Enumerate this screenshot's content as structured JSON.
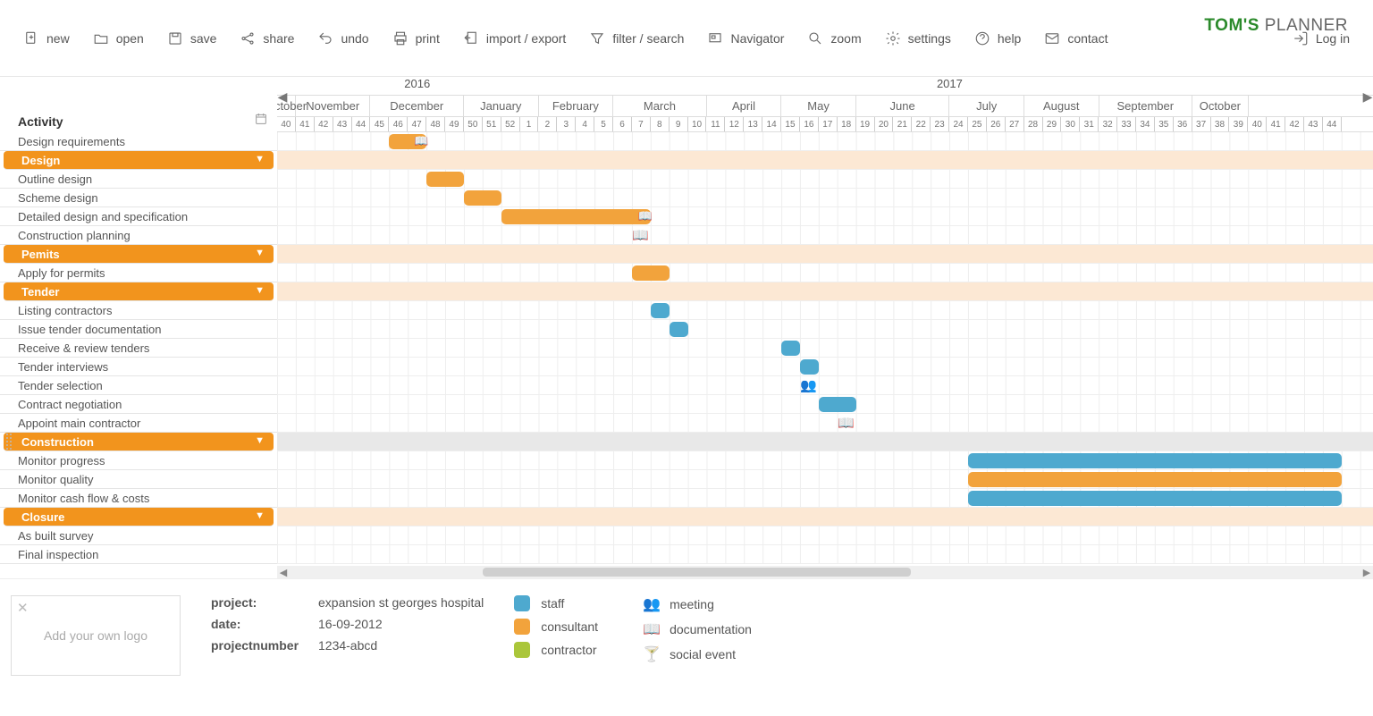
{
  "brand": {
    "strong": "TOM'S",
    "light": " PLANNER"
  },
  "toolbar": {
    "items": [
      "new",
      "open",
      "save",
      "share",
      "undo",
      "print",
      "import / export",
      "filter / search",
      "Navigator",
      "zoom",
      "settings",
      "help",
      "contact"
    ],
    "login": "Log in"
  },
  "timeline": {
    "years": [
      {
        "label": "2016",
        "span": 15
      },
      {
        "label": "2017",
        "span": 42
      }
    ],
    "months": [
      {
        "label": "October",
        "weeks": 1
      },
      {
        "label": "November",
        "weeks": 4
      },
      {
        "label": "December",
        "weeks": 5
      },
      {
        "label": "January",
        "weeks": 4
      },
      {
        "label": "February",
        "weeks": 4
      },
      {
        "label": "March",
        "weeks": 5
      },
      {
        "label": "April",
        "weeks": 4
      },
      {
        "label": "May",
        "weeks": 4
      },
      {
        "label": "June",
        "weeks": 5
      },
      {
        "label": "July",
        "weeks": 4
      },
      {
        "label": "August",
        "weeks": 4
      },
      {
        "label": "September",
        "weeks": 5
      },
      {
        "label": "October",
        "weeks": 3
      }
    ],
    "weeks": [
      40,
      41,
      42,
      43,
      44,
      45,
      46,
      47,
      48,
      49,
      50,
      51,
      52,
      1,
      2,
      3,
      4,
      5,
      6,
      7,
      8,
      9,
      10,
      11,
      12,
      13,
      14,
      15,
      16,
      17,
      18,
      19,
      20,
      21,
      22,
      23,
      24,
      25,
      26,
      27,
      28,
      29,
      30,
      31,
      32,
      33,
      34,
      35,
      36,
      37,
      38,
      39,
      40,
      41,
      42,
      43,
      44
    ]
  },
  "activity_header": "Activity",
  "rows": [
    {
      "label": "Design requirements",
      "type": "task",
      "bar": {
        "start": 6,
        "span": 2,
        "color": "orange",
        "icon": "📖"
      }
    },
    {
      "label": "Design",
      "type": "group"
    },
    {
      "label": "Outline design",
      "type": "task",
      "bar": {
        "start": 8,
        "span": 2,
        "color": "orange"
      }
    },
    {
      "label": "Scheme design",
      "type": "task",
      "bar": {
        "start": 10,
        "span": 2,
        "color": "orange"
      }
    },
    {
      "label": "Detailed design and specification",
      "type": "task",
      "bar": {
        "start": 12,
        "span": 8,
        "color": "orange",
        "icon": "📖"
      }
    },
    {
      "label": "Construction planning",
      "type": "task",
      "mark": {
        "at": 19,
        "icon": "📖"
      }
    },
    {
      "label": "Pemits",
      "type": "group"
    },
    {
      "label": "Apply for permits",
      "type": "task",
      "bar": {
        "start": 19,
        "span": 2,
        "color": "orange"
      }
    },
    {
      "label": "Tender",
      "type": "group"
    },
    {
      "label": "Listing contractors",
      "type": "task",
      "bar": {
        "start": 20,
        "span": 1,
        "color": "blue"
      }
    },
    {
      "label": "Issue tender documentation",
      "type": "task",
      "bar": {
        "start": 21,
        "span": 1,
        "color": "blue"
      }
    },
    {
      "label": "Receive  & review tenders",
      "type": "task",
      "bar": {
        "start": 27,
        "span": 1,
        "color": "blue"
      }
    },
    {
      "label": "Tender interviews",
      "type": "task",
      "bar": {
        "start": 28,
        "span": 1,
        "color": "blue"
      }
    },
    {
      "label": "Tender selection",
      "type": "task",
      "mark": {
        "at": 28,
        "icon": "👥"
      }
    },
    {
      "label": "Contract negotiation",
      "type": "task",
      "bar": {
        "start": 29,
        "span": 2,
        "color": "blue"
      }
    },
    {
      "label": "Appoint main contractor",
      "type": "task",
      "mark": {
        "at": 30,
        "icon": "📖"
      }
    },
    {
      "label": "Construction",
      "type": "group",
      "selected": true,
      "highlight": true
    },
    {
      "label": "Monitor progress",
      "type": "task",
      "bar": {
        "start": 37,
        "span": 20,
        "color": "blue"
      }
    },
    {
      "label": "Monitor quality",
      "type": "task",
      "bar": {
        "start": 37,
        "span": 20,
        "color": "orange"
      }
    },
    {
      "label": "Monitor cash flow & costs",
      "type": "task",
      "bar": {
        "start": 37,
        "span": 20,
        "color": "blue"
      }
    },
    {
      "label": "Closure",
      "type": "group"
    },
    {
      "label": "As built survey",
      "type": "task"
    },
    {
      "label": "Final inspection",
      "type": "task"
    }
  ],
  "footer": {
    "logo_placeholder": "Add your own logo",
    "meta": [
      {
        "label": "project:",
        "value": "expansion st georges hospital"
      },
      {
        "label": "date:",
        "value": "16-09-2012"
      },
      {
        "label": "projectnumber",
        "value": "1234-abcd"
      }
    ],
    "legend_left": [
      {
        "swatch": "blue",
        "label": "staff"
      },
      {
        "swatch": "orange",
        "label": "consultant"
      },
      {
        "swatch": "green",
        "label": "contractor"
      }
    ],
    "legend_right": [
      {
        "icon": "👥",
        "label": "meeting"
      },
      {
        "icon": "📖",
        "label": "documentation"
      },
      {
        "icon": "🍸",
        "label": "social event"
      }
    ]
  }
}
